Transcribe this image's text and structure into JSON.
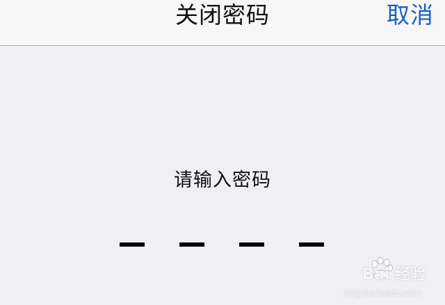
{
  "nav": {
    "title": "关闭密码",
    "cancel_label": "取消"
  },
  "prompt": "请输入密码",
  "passcode": {
    "length": 4,
    "entered": 0
  },
  "watermark": {
    "brand": "Bai 经验",
    "url": "jingyan.baidu.com"
  },
  "colors": {
    "background": "#efeff4",
    "nav_background": "#f7f7f7",
    "accent": "#1a5fc4"
  }
}
